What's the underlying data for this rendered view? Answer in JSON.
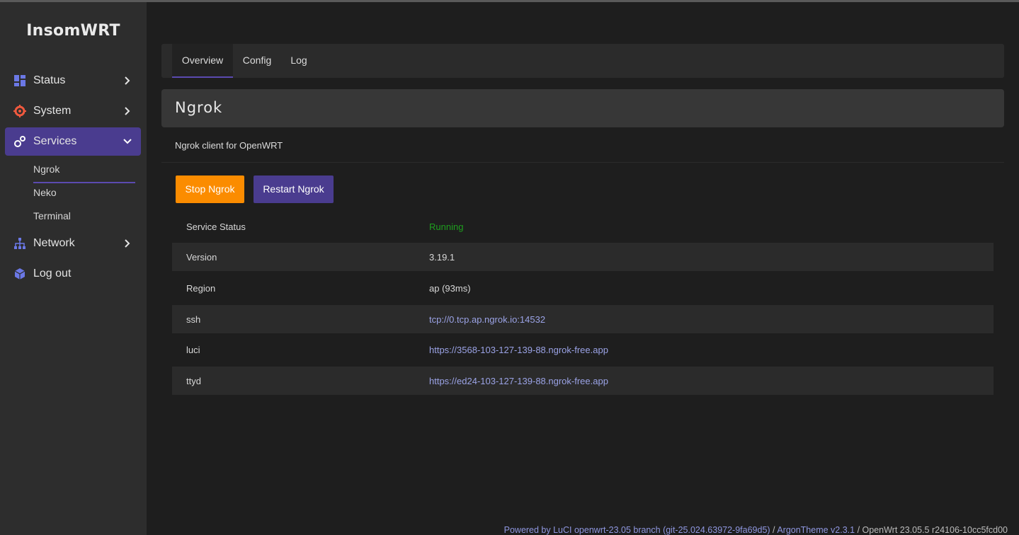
{
  "brand": "InsomWRT",
  "sidebar": {
    "items": [
      {
        "label": "Status",
        "icon": "dashboard-icon"
      },
      {
        "label": "System",
        "icon": "gear-icon"
      },
      {
        "label": "Services",
        "icon": "services-icon"
      },
      {
        "label": "Network",
        "icon": "network-icon"
      },
      {
        "label": "Log out",
        "icon": "cube-icon"
      }
    ],
    "services_sub": [
      "Ngrok",
      "Neko",
      "Terminal"
    ],
    "active_color": "#4a3c8f"
  },
  "tabs": [
    "Overview",
    "Config",
    "Log"
  ],
  "page": {
    "title": "Ngrok",
    "description": "Ngrok client for OpenWRT",
    "stop_label": "Stop Ngrok",
    "restart_label": "Restart Ngrok",
    "stop_color": "#fb8c00",
    "restart_color": "#4a3c8f"
  },
  "status_table": [
    {
      "key": "Service Status",
      "value": "Running"
    },
    {
      "key": "Version",
      "value": "3.19.1"
    },
    {
      "key": "Region",
      "value": "ap (93ms)"
    },
    {
      "key": "ssh",
      "value": "tcp://0.tcp.ap.ngrok.io:14532"
    },
    {
      "key": "luci",
      "value": "https://3568-103-127-139-88.ngrok-free.app"
    },
    {
      "key": "ttyd",
      "value": "https://ed24-103-127-139-88.ngrok-free.app"
    }
  ],
  "footer": {
    "luci": "Powered by LuCI openwrt-23.05 branch (git-25.024.63972-9fa69d5)",
    "sep1": " / ",
    "theme": "ArgonTheme v2.3.1",
    "sep2": " / ",
    "os": "OpenWrt 23.05.5 r24106-10cc5fcd00"
  }
}
